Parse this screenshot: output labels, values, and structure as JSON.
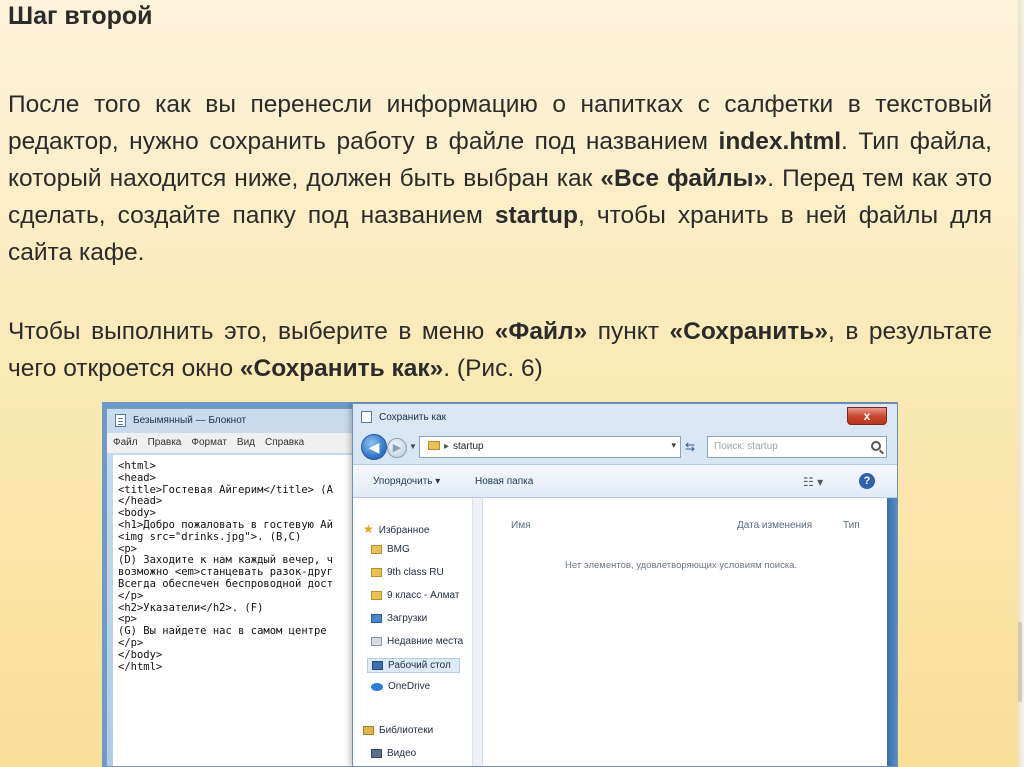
{
  "heading": "Шаг второй",
  "paragraph1": {
    "t1": "После того как вы перенесли информацию о напитках с салфетки в текстовый редактор, нужно сохранить работу в файле под названием ",
    "b1": "index.html",
    "t2": ". Тип файла, который находится ниже, должен быть выбран как ",
    "b2": "«Все файлы»",
    "t3": ". Перед тем как это сделать, создайте папку под названием ",
    "b3": "startup",
    "t4": ", чтобы хранить в ней файлы для сайта кафе."
  },
  "paragraph2": {
    "t1": "Чтобы выполнить это, выберите в меню ",
    "b1": "«Файл»",
    "t2": " пункт ",
    "b2": "«Сохранить»",
    "t3": ", в результате чего откроется окно ",
    "b3": "«Сохранить как»",
    "t4": ". (Рис. 6)"
  },
  "notepad": {
    "title": "Безымянный — Блокнот",
    "menu": [
      "Файл",
      "Правка",
      "Формат",
      "Вид",
      "Справка"
    ],
    "lines": [
      "<html>",
      "<head>",
      "<title>Гостевая Айгерим</title> (A",
      "</head>",
      "<body>",
      "<h1>Добро пожаловать в гостевую Ай",
      "<img src=\"drinks.jpg\">. (B,C)",
      "<p>",
      "(D) Заходите к нам каждый вечер, ч",
      "возможно <em>станцевать разок-друг",
      "Всегда обеспечен беспроводной дост",
      "</p>",
      "<h2>Указатели</h2>. (F)",
      "<p>",
      "(G) Вы найдете нас в самом центре ",
      "</p>",
      "</body>",
      "</html>"
    ]
  },
  "dialog": {
    "title": "Сохранить как",
    "close_label": "x",
    "address": {
      "folder": "startup",
      "arrow": "▸"
    },
    "search_placeholder": "Поиск: startup",
    "toolbar": {
      "organize": "Упорядочить ▾",
      "new_folder": "Новая папка",
      "view": "☷ ▾",
      "help": "?"
    },
    "nav_items": [
      "Избранное",
      "BMG",
      "9th class RU",
      "9 класс - Алмат",
      "Загрузки",
      "Недавние места",
      "Рабочий стол",
      "OneDrive",
      "Библиотеки",
      "Видео"
    ],
    "columns": [
      "Имя",
      "Дата изменения",
      "Тип"
    ],
    "empty_message": "Нет элементов, удовлетворяющих условиям поиска."
  }
}
